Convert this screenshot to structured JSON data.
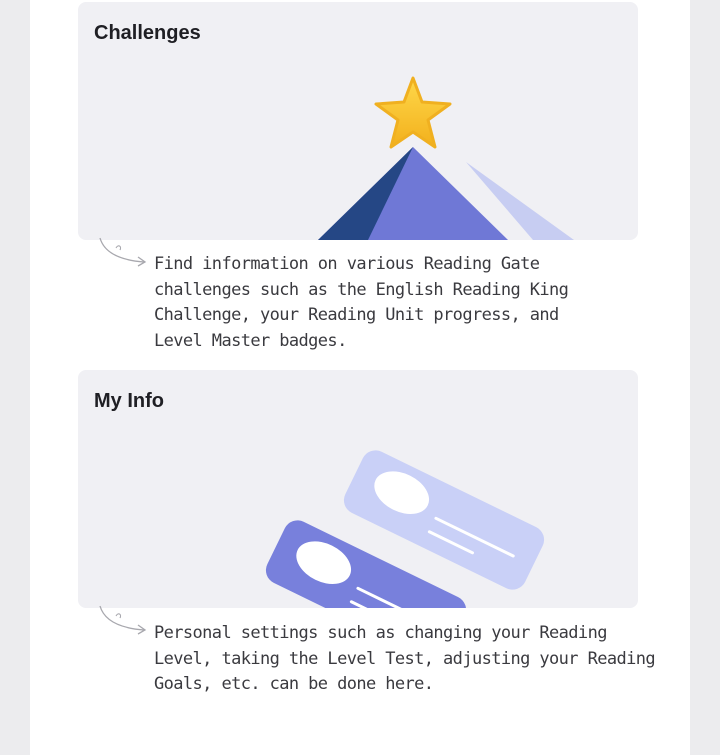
{
  "sections": [
    {
      "title": "Challenges",
      "icon": "mountain-star-icon",
      "description": "Find information on various Reading Gate\nchallenges such as the English Reading King\nChallenge, your Reading Unit progress, and\nLevel Master badges."
    },
    {
      "title": "My Info",
      "icon": "profile-cards-icon",
      "description": "Personal settings such as changing your Reading\nLevel, taking the Level Test, adjusting your Reading\nGoals, etc. can be done here."
    }
  ],
  "colors": {
    "card_bg": "#f0f0f4",
    "star": "#f6c12a",
    "mountain_dark": "#254785",
    "mountain_main": "#6f78d6",
    "mountain_light": "#c7cdf2",
    "card_front": "#7880dc",
    "card_back": "#c9d0f7"
  }
}
